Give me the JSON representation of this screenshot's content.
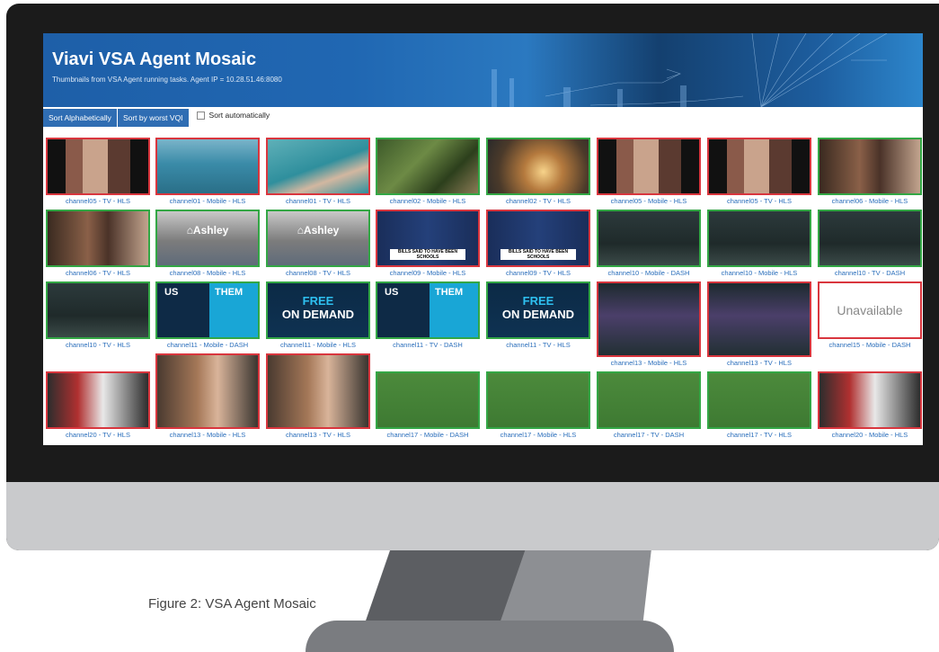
{
  "header": {
    "title": "Viavi VSA Agent Mosaic",
    "subtitle": "Thumbnails from VSA Agent running tasks. Agent IP = 10.28.51.46:8080"
  },
  "toolbar": {
    "sort_alpha_label": "Sort Alphabetically",
    "sort_vql_label": "Sort by worst VQI",
    "sort_auto_label": "Sort automatically"
  },
  "caption": "Figure 2: VSA Agent Mosaic",
  "colors": {
    "good": "#33a745",
    "bad": "#d9363e",
    "link": "#2a6ebb"
  },
  "tiles": [
    {
      "label": "channel05 - TV - HLS",
      "status": "bad",
      "scene": "indoor"
    },
    {
      "label": "channel01 - Mobile - HLS",
      "status": "bad",
      "scene": "pool"
    },
    {
      "label": "channel01 - TV - HLS",
      "status": "bad",
      "scene": "pool2"
    },
    {
      "label": "channel02 - Mobile - HLS",
      "status": "good",
      "scene": "forest"
    },
    {
      "label": "channel02 - TV - HLS",
      "status": "good",
      "scene": "sparks"
    },
    {
      "label": "channel05 - Mobile - HLS",
      "status": "bad",
      "scene": "indoor"
    },
    {
      "label": "channel05 - TV - HLS",
      "status": "bad",
      "scene": "indoor"
    },
    {
      "label": "channel06 - Mobile - HLS",
      "status": "good",
      "scene": "couple"
    },
    {
      "label": "channel06 - TV - HLS",
      "status": "good",
      "scene": "couple"
    },
    {
      "label": "channel08 - Mobile - HLS",
      "status": "good",
      "scene": "store",
      "text": "⌂Ashley"
    },
    {
      "label": "channel08 - TV - HLS",
      "status": "good",
      "scene": "store",
      "text": "⌂Ashley"
    },
    {
      "label": "channel09 - Mobile - HLS",
      "status": "bad",
      "scene": "news",
      "text": "BILLS SAID TO HAVE BEEN SCHOOLS"
    },
    {
      "label": "channel09 - TV - HLS",
      "status": "bad",
      "scene": "news",
      "text": "BILLS SAID TO HAVE BEEN SCHOOLS"
    },
    {
      "label": "channel10 - Mobile - DASH",
      "status": "good",
      "scene": "dark"
    },
    {
      "label": "channel10 - Mobile - HLS",
      "status": "good",
      "scene": "dark"
    },
    {
      "label": "channel10 - TV - DASH",
      "status": "good",
      "scene": "dark"
    },
    {
      "label": "channel10 - TV - HLS",
      "status": "good",
      "scene": "dark"
    },
    {
      "label": "channel11 - Mobile - DASH",
      "status": "good",
      "scene": "usthem",
      "text": "US",
      "text2": "THEM"
    },
    {
      "label": "channel11 - Mobile - HLS",
      "status": "good",
      "scene": "free",
      "text": "FREE",
      "text2": "ON DEMAND"
    },
    {
      "label": "channel11 - TV - DASH",
      "status": "good",
      "scene": "usthem",
      "text": "US",
      "text2": "THEM"
    },
    {
      "label": "channel11 - TV - HLS",
      "status": "good",
      "scene": "free",
      "text": "FREE",
      "text2": "ON DEMAND"
    },
    {
      "label": "channel13 - Mobile - HLS",
      "status": "bad",
      "scene": "cartoon",
      "tall": true
    },
    {
      "label": "channel13 - TV - HLS",
      "status": "bad",
      "scene": "cartoon",
      "tall": true
    },
    {
      "label": "channel15 - Mobile - DASH",
      "status": "bad",
      "scene": "unavailable",
      "text": "Unavailable"
    },
    {
      "label": "channel20 - TV - HLS",
      "status": "bad",
      "scene": "baseball"
    },
    {
      "label": "channel13 - Mobile - HLS",
      "status": "bad",
      "scene": "woman",
      "tall": true
    },
    {
      "label": "channel13 - TV - HLS",
      "status": "bad",
      "scene": "woman",
      "tall": true
    },
    {
      "label": "channel17 - Mobile - DASH",
      "status": "good",
      "scene": "golf"
    },
    {
      "label": "channel17 - Mobile - HLS",
      "status": "good",
      "scene": "golf"
    },
    {
      "label": "channel17 - TV - DASH",
      "status": "good",
      "scene": "golf"
    },
    {
      "label": "channel17 - TV - HLS",
      "status": "good",
      "scene": "golf"
    },
    {
      "label": "channel20 - Mobile - HLS",
      "status": "bad",
      "scene": "baseball"
    }
  ]
}
